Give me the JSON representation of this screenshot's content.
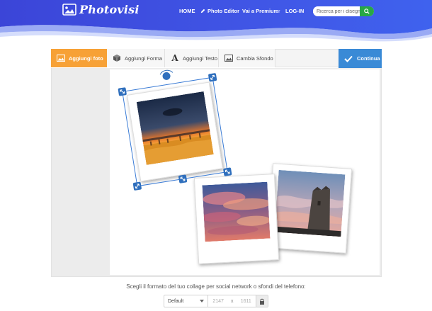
{
  "header": {
    "logo_text": "Photovisi",
    "nav": {
      "home": "HOME",
      "photo_editor": "Photo Editor",
      "premium": "Vai a Premium",
      "or": "or",
      "login": "LOG-IN"
    },
    "search_placeholder": "Ricerca per i disegni"
  },
  "toolbar": {
    "add_photo": "Aggiungi foto",
    "add_shape": "Aggiungi Forma",
    "add_text": "Aggiungi Testo",
    "change_bg": "Cambia Sfondo",
    "continue": "Continua"
  },
  "format": {
    "label": "Scegli il formato del tuo collage per social network o sfondi del telefono:",
    "selected": "Default",
    "width": "2147",
    "x": "x",
    "height": "1611"
  },
  "colors": {
    "header_blue": "#3d4fe0",
    "accent_orange": "#f7a136",
    "continue_blue": "#3a8ad6",
    "handle_blue": "#2f6fbd",
    "search_green": "#28a745"
  }
}
